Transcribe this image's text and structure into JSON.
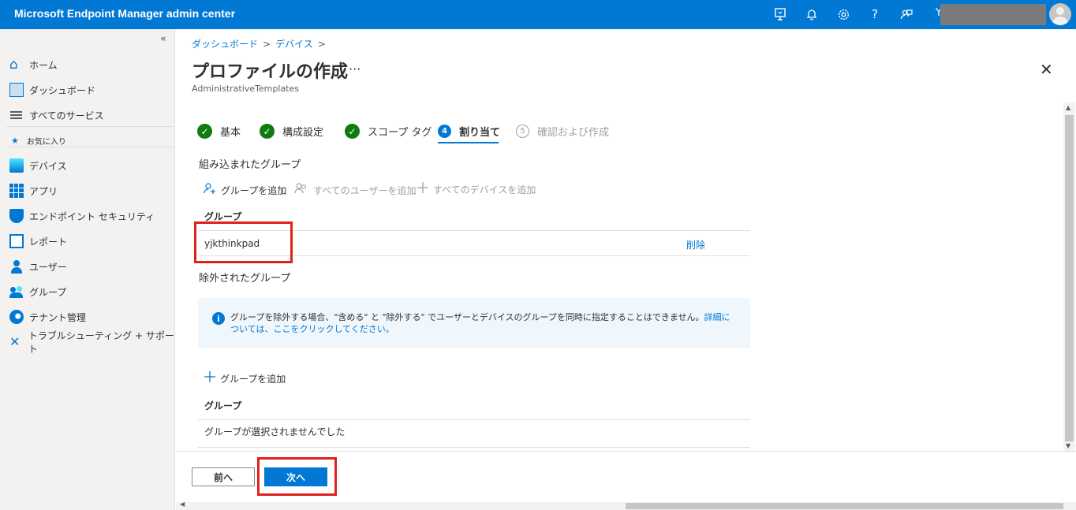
{
  "app": {
    "title": "Microsoft Endpoint Manager admin center",
    "user_initial": "Y"
  },
  "topbar_icons": [
    "feedback-device-icon",
    "bell-icon",
    "gear-icon",
    "help-icon",
    "person-feedback-icon"
  ],
  "sidebar": {
    "collapse": "«",
    "items": [
      {
        "label": "ホーム",
        "icon": "home-icon"
      },
      {
        "label": "ダッシュボード",
        "icon": "dashboard-icon"
      },
      {
        "label": "すべてのサービス",
        "icon": "list-icon"
      },
      {
        "label": "デバイス",
        "icon": "devices-icon"
      },
      {
        "label": "アプリ",
        "icon": "apps-icon"
      },
      {
        "label": "エンドポイント セキュリティ",
        "icon": "shield-icon"
      },
      {
        "label": "レポート",
        "icon": "reports-icon"
      },
      {
        "label": "ユーザー",
        "icon": "user-icon"
      },
      {
        "label": "グループ",
        "icon": "groups-icon"
      },
      {
        "label": "テナント管理",
        "icon": "tenant-admin-icon"
      },
      {
        "label": "トラブルシューティング + サポート",
        "icon": "tools-icon"
      }
    ],
    "favorites_label": "お気に入り"
  },
  "breadcrumb": {
    "items": [
      "ダッシュボード",
      "デバイス"
    ],
    "separator": ">"
  },
  "page": {
    "title": "プロファイルの作成",
    "subtitle": "AdministrativeTemplates",
    "more": "···",
    "close": "✕"
  },
  "steps": [
    {
      "label": "基本",
      "state": "complete",
      "marker": "✓"
    },
    {
      "label": "構成設定",
      "state": "complete",
      "marker": "✓"
    },
    {
      "label": "スコープ タグ",
      "state": "complete",
      "marker": "✓"
    },
    {
      "label": "割り当て",
      "state": "active",
      "marker": "4"
    },
    {
      "label": "確認および作成",
      "state": "disabled",
      "marker": "5"
    }
  ],
  "included": {
    "title": "組み込まれたグループ",
    "commands": [
      {
        "label": "グループを追加",
        "icon": "add-user-icon",
        "enabled": true
      },
      {
        "label": "すべてのユーザーを追加",
        "icon": "add-all-users-icon",
        "enabled": false
      },
      {
        "label": "すべてのデバイスを追加",
        "icon": "plus-icon",
        "enabled": false
      }
    ],
    "column_header": "グループ",
    "rows": [
      {
        "group": "yjkthinkpad",
        "action": "削除"
      }
    ]
  },
  "excluded": {
    "title": "除外されたグループ",
    "info_text": "グループを除外する場合、\"含める\" と \"除外する\" でユーザーとデバイスのグループを同時に指定することはできません。",
    "info_link": "詳細については、ここをクリックしてください。",
    "add_label": "グループを追加",
    "column_header": "グループ",
    "empty_text": "グループが選択されませんでした"
  },
  "footer": {
    "prev_label": "前へ",
    "next_label": "次へ"
  },
  "colors": {
    "brand": "#0078d4",
    "success": "#107c10",
    "highlight": "#e0201b"
  }
}
